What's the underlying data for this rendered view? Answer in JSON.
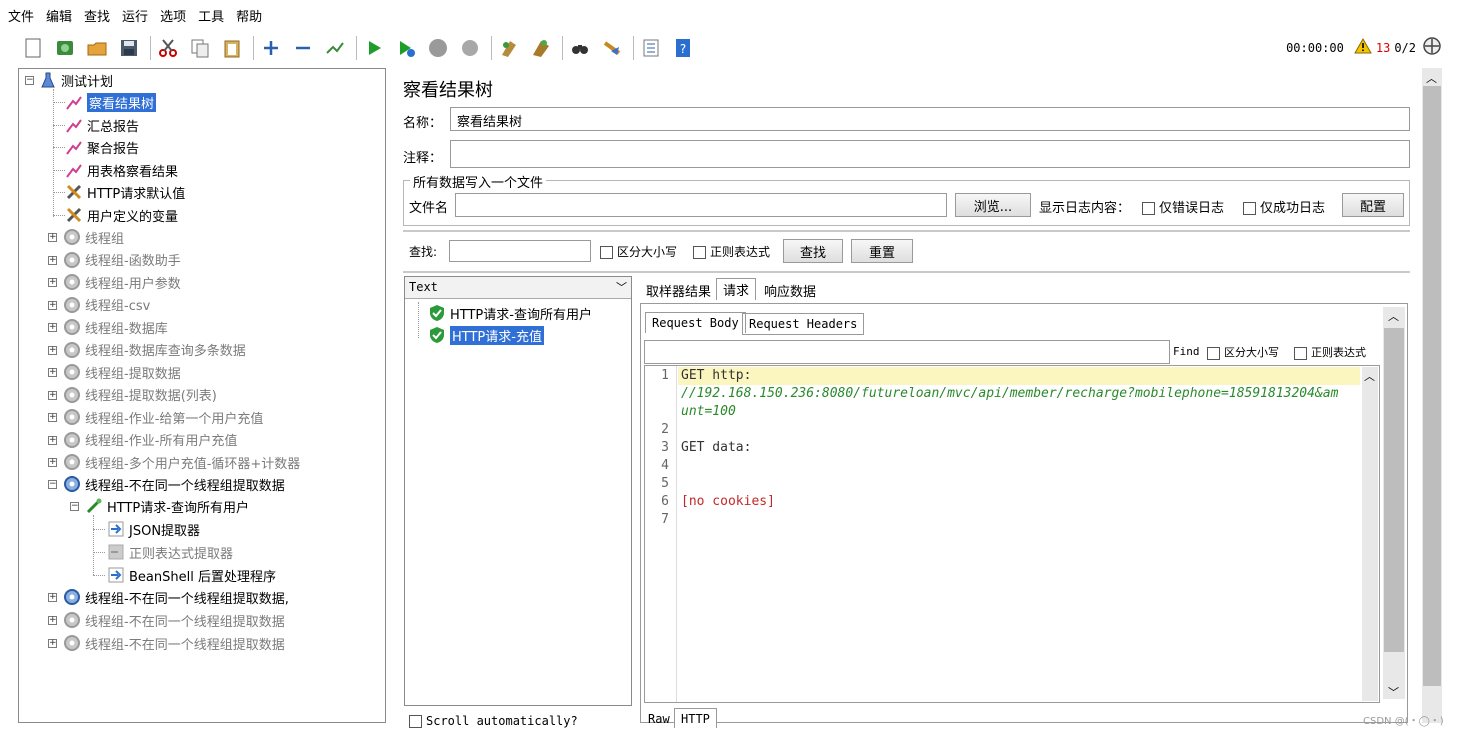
{
  "menu": [
    "文件",
    "编辑",
    "查找",
    "运行",
    "选项",
    "工具",
    "帮助"
  ],
  "toolbar": {
    "timer": "00:00:00",
    "warning_count": "13",
    "threads": "0/2"
  },
  "tree": {
    "root": "测试计划",
    "items": [
      {
        "label": "察看结果树",
        "selected": true
      },
      {
        "label": "汇总报告"
      },
      {
        "label": "聚合报告"
      },
      {
        "label": "用表格察看结果"
      },
      {
        "label": "HTTP请求默认值"
      },
      {
        "label": "用户定义的变量"
      },
      {
        "label": "线程组",
        "disabled": true
      },
      {
        "label": "线程组-函数助手",
        "disabled": true
      },
      {
        "label": "线程组-用户参数",
        "disabled": true
      },
      {
        "label": "线程组-csv",
        "disabled": true
      },
      {
        "label": "线程组-数据库",
        "disabled": true
      },
      {
        "label": "线程组-数据库查询多条数据",
        "disabled": true
      },
      {
        "label": "线程组-提取数据",
        "disabled": true
      },
      {
        "label": "线程组-提取数据(列表)",
        "disabled": true
      },
      {
        "label": "线程组-作业-给第一个用户充值",
        "disabled": true
      },
      {
        "label": "线程组-作业-所有用户充值",
        "disabled": true
      },
      {
        "label": "线程组-多个用户充值-循环器+计数器",
        "disabled": true
      },
      {
        "label": "线程组-不在同一个线程组提取数据"
      },
      {
        "label": "HTTP请求-查询所有用户"
      },
      {
        "label": "JSON提取器"
      },
      {
        "label": "正则表达式提取器",
        "disabled": true
      },
      {
        "label": "BeanShell 后置处理程序"
      },
      {
        "label": "线程组-不在同一个线程组提取数据,"
      },
      {
        "label": "线程组-不在同一个线程组提取数据",
        "disabled": true
      },
      {
        "label": "线程组-不在同一个线程组提取数据",
        "disabled": true
      }
    ]
  },
  "panel": {
    "title": "察看结果树",
    "name_label": "名称：",
    "name_value": "察看结果树",
    "comment_label": "注释：",
    "comment_value": "",
    "file_group_label": "所有数据写入一个文件",
    "filename_label": "文件名",
    "filename_value": "",
    "browse_button": "浏览...",
    "log_label": "显示日志内容：",
    "errors_only": "仅错误日志",
    "success_only": "仅成功日志",
    "config_button": "配置",
    "search_label": "查找:",
    "search_value": "",
    "case_sensitive": "区分大小写",
    "regex": "正则表达式",
    "find_button": "查找",
    "reset_button": "重置"
  },
  "results": {
    "renderer": "Text",
    "items": [
      "HTTP请求-查询所有用户",
      "HTTP请求-充值"
    ],
    "selected_index": 1,
    "scroll_auto": "Scroll automatically?"
  },
  "tabs": [
    "取样器结果",
    "请求",
    "响应数据"
  ],
  "active_tab": "请求",
  "subtabs": [
    "Request Body",
    "Request Headers"
  ],
  "find": {
    "label": "Find",
    "case_sensitive": "区分大小写",
    "regex": "正则表达式"
  },
  "code_lines": [
    {
      "num": "1",
      "text": "GET http:",
      "color": "#333333"
    },
    {
      "num": "",
      "text": "//192.168.150.236:8080/futureloan/mvc/api/member/recharge?mobilephone=18591813204&am",
      "color": "#2a8a2a"
    },
    {
      "num": "",
      "text": "unt=100",
      "color": "#2a8a2a"
    },
    {
      "num": "2",
      "text": "",
      "color": "#333333"
    },
    {
      "num": "3",
      "text": "GET data:",
      "color": "#333333"
    },
    {
      "num": "4",
      "text": "",
      "color": "#333333"
    },
    {
      "num": "5",
      "text": "",
      "color": "#333333"
    },
    {
      "num": "6",
      "text": "[no cookies]",
      "color": "#c62828"
    },
    {
      "num": "7",
      "text": "",
      "color": "#333333"
    }
  ],
  "bottom_tabs": [
    "Raw",
    "HTTP"
  ],
  "watermark": "CSDN @(・◯・)"
}
